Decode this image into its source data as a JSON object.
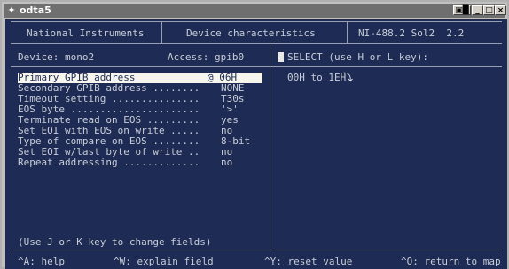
{
  "window": {
    "title": "odta5",
    "controls": {
      "special": "▣█",
      "minimize": "_",
      "maximize": "□",
      "close": "×"
    }
  },
  "header": {
    "left": "National Instruments",
    "center": "Device characteristics",
    "right": "NI-488.2 Sol2  2.2"
  },
  "device": {
    "device_label": "Device: mono2",
    "access_label": "Access: gpib0",
    "select_prompt": "SELECT (use H or L key):"
  },
  "fields": [
    {
      "label": "Primary GPIB address",
      "value": "@ 06H"
    },
    {
      "label": "Secondary GPIB address ........",
      "value": "NONE"
    },
    {
      "label": "Timeout setting ...............",
      "value": "T30s"
    },
    {
      "label": "EOS byte ......................",
      "value": "'>'"
    },
    {
      "label": "Terminate read on EOS .........",
      "value": "yes"
    },
    {
      "label": "Set EOI with EOS on write .....",
      "value": "no"
    },
    {
      "label": "Type of compare on EOS ........",
      "value": "8-bit"
    },
    {
      "label": "Set EOI w/last byte of write ..",
      "value": "no"
    },
    {
      "label": "Repeat addressing .............",
      "value": "no"
    }
  ],
  "selection": {
    "range": "00H to 1EH"
  },
  "hint": "(Use J or K key to change fields)",
  "footer": [
    {
      "text": "^A: help"
    },
    {
      "text": "^W: explain field"
    },
    {
      "text": "^Y: reset value"
    },
    {
      "text": "^O: return to map"
    }
  ]
}
